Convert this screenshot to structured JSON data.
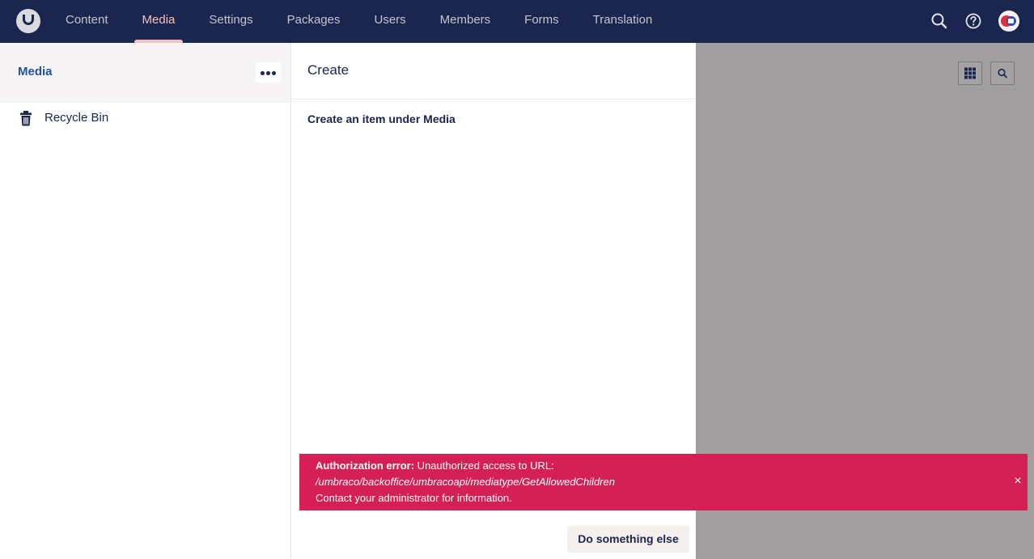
{
  "topbar": {
    "logo": "umbraco-logo",
    "nav": [
      {
        "label": "Content",
        "active": false
      },
      {
        "label": "Media",
        "active": true
      },
      {
        "label": "Settings",
        "active": false
      },
      {
        "label": "Packages",
        "active": false
      },
      {
        "label": "Users",
        "active": false
      },
      {
        "label": "Members",
        "active": false
      },
      {
        "label": "Forms",
        "active": false
      },
      {
        "label": "Translation",
        "active": false
      }
    ],
    "icons": [
      "search-icon",
      "help-icon",
      "user-avatar"
    ]
  },
  "tree": {
    "title": "Media",
    "menu_icon": "ellipsis-icon",
    "items": [
      {
        "label": "Recycle Bin",
        "icon": "trash-icon"
      }
    ]
  },
  "dialog": {
    "title": "Create",
    "subtitle": "Create an item under Media",
    "secondary_button": "Do something else"
  },
  "notification": {
    "type": "error",
    "heading": "Authorization error:",
    "message": " Unauthorized access to URL:",
    "url": "/umbraco/backoffice/umbracoapi/mediatype/GetAllowedChildren",
    "footer": "Contact your administrator for information.",
    "close_label": "×",
    "color": "#d42054"
  },
  "content_tools": {
    "icons": [
      "grid-view-icon",
      "search-icon"
    ]
  },
  "colors": {
    "topbar": "#1b264f",
    "nav_active": "#f5c1bc",
    "tree_title": "#2152a3",
    "overlay": "#a09e9e"
  }
}
